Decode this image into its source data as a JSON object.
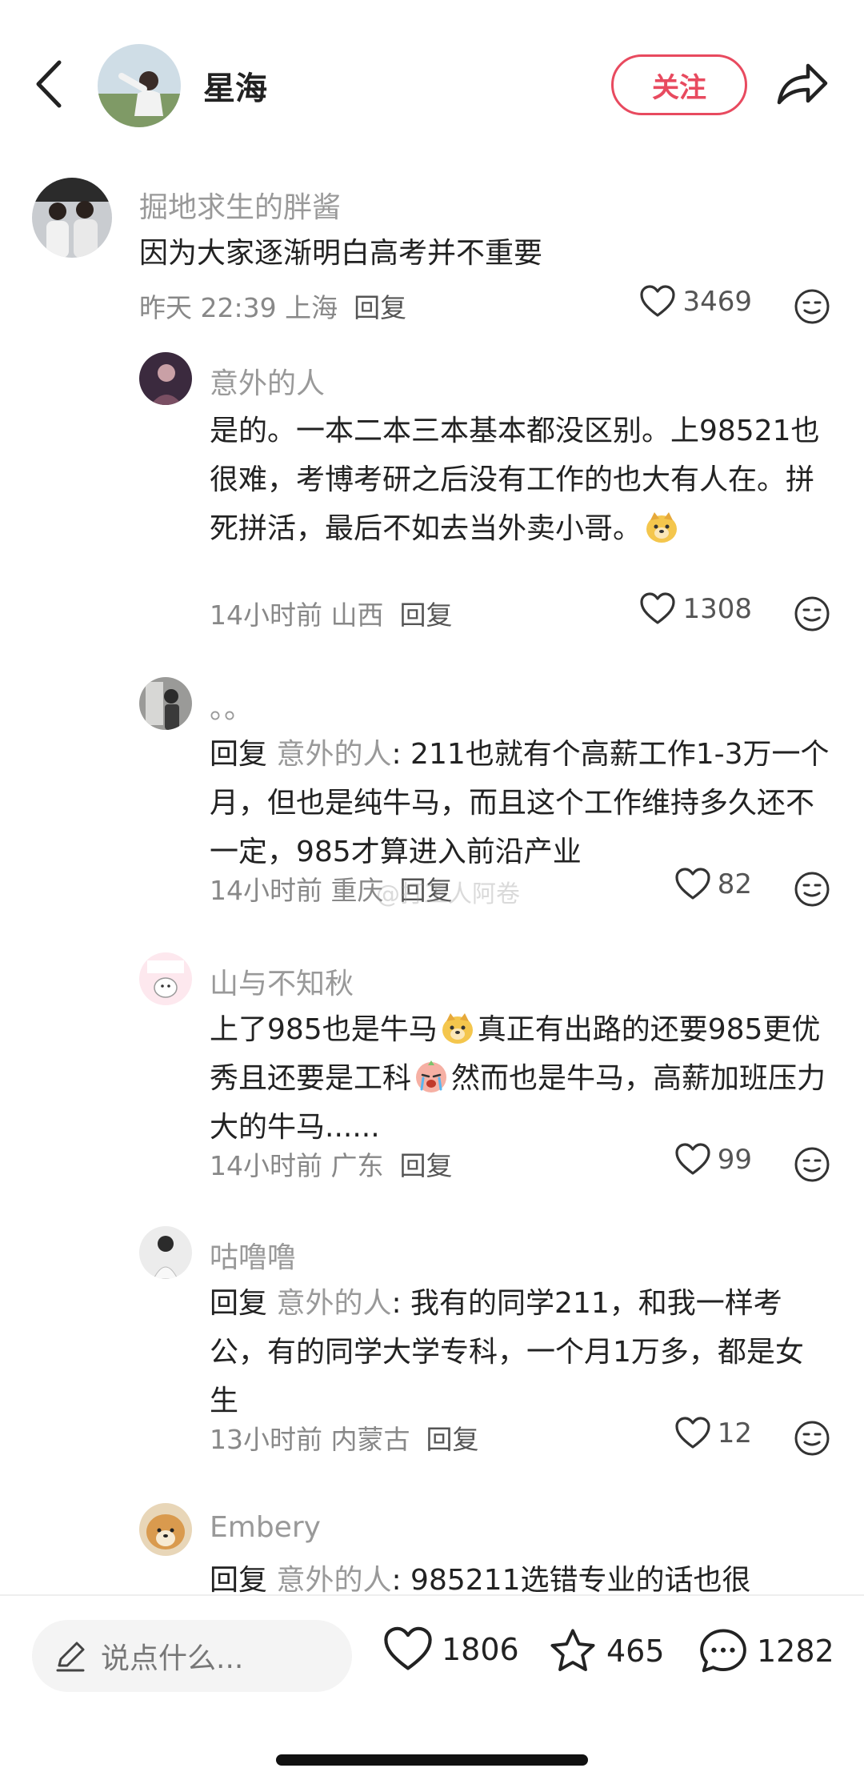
{
  "header": {
    "author_name": "星海",
    "follow_label": "关注"
  },
  "comments": [
    {
      "user": "掘地求生的胖酱",
      "text": "因为大家逐渐明白高考并不重要",
      "time": "昨天 22:39 上海",
      "reply_label": "回复",
      "likes": "3469"
    },
    {
      "user": "意外的人",
      "text": "是的。一本二本三本基本都没区别。上98521也很难，考博考研之后没有工作的也大有人在。拼死拼活，最后不如去当外卖小哥。",
      "time": "14小时前 山西",
      "reply_label": "回复",
      "likes": "1308"
    },
    {
      "user": "。。",
      "reply_prefix": "回复 ",
      "reply_to": "意外的人",
      "text": ": 211也就有个高薪工作1-3万一个月，但也是纯牛马，而且这个工作维持多久还不一定，985才算进入前沿产业",
      "time": "14小时前 重庆",
      "reply_label": "回复",
      "likes": "82"
    },
    {
      "user": "山与不知秋",
      "text_a": "上了985也是牛马",
      "text_b": "真正有出路的还要985更优秀且还要是工科",
      "text_c": "然而也是牛马，高薪加班压力大的牛马......",
      "time": "14小时前 广东",
      "reply_label": "回复",
      "likes": "99"
    },
    {
      "user": "咕噜噜",
      "reply_prefix": "回复 ",
      "reply_to": "意外的人",
      "text": ": 我有的同学211，和我一样考公，有的同学大学专科，一个月1万多，都是女生",
      "time": "13小时前 内蒙古",
      "reply_label": "回复",
      "likes": "12"
    },
    {
      "user": "Embery",
      "reply_prefix": "回复 ",
      "reply_to": "意外的人",
      "text": ": 985211选错专业的话也很"
    }
  ],
  "watermark": "@打工人阿卷",
  "bottom_bar": {
    "placeholder": "说点什么...",
    "likes": "1806",
    "stars": "465",
    "comments": "1282"
  }
}
